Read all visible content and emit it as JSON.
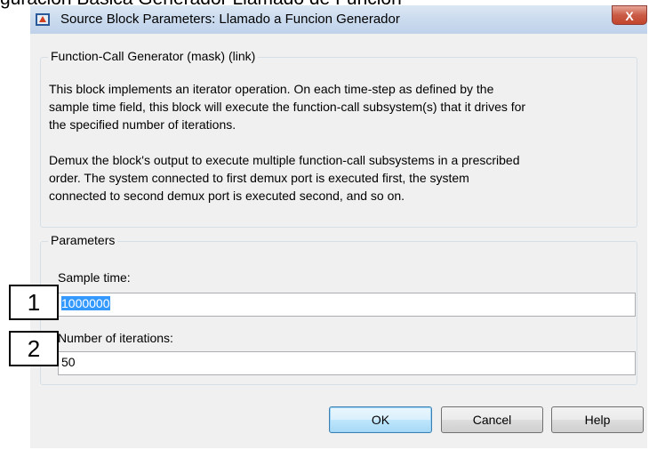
{
  "caption": "guración Básica Generador Llamado de Función",
  "window": {
    "title": "Source Block Parameters: Llamado a Funcion Generador",
    "close_label": "X"
  },
  "description_group": {
    "legend": "Function-Call Generator (mask) (link)",
    "lines": [
      "This block implements an iterator operation. On each time-step as defined by the",
      "sample time field, this block will execute the function-call subsystem(s) that it drives for",
      "the specified number of iterations.",
      "",
      "Demux the block's output to execute multiple function-call subsystems in a prescribed",
      "order.  The system connected to first demux port is executed first, the system",
      "connected to second demux port is executed second, and so on."
    ]
  },
  "parameters_group": {
    "legend": "Parameters",
    "sample_time": {
      "label": "Sample time:",
      "value": "1000000"
    },
    "iterations": {
      "label": "Number of iterations:",
      "value": "50"
    }
  },
  "buttons": {
    "ok": "OK",
    "cancel": "Cancel",
    "help": "Help"
  },
  "annotations": [
    "1",
    "2"
  ]
}
